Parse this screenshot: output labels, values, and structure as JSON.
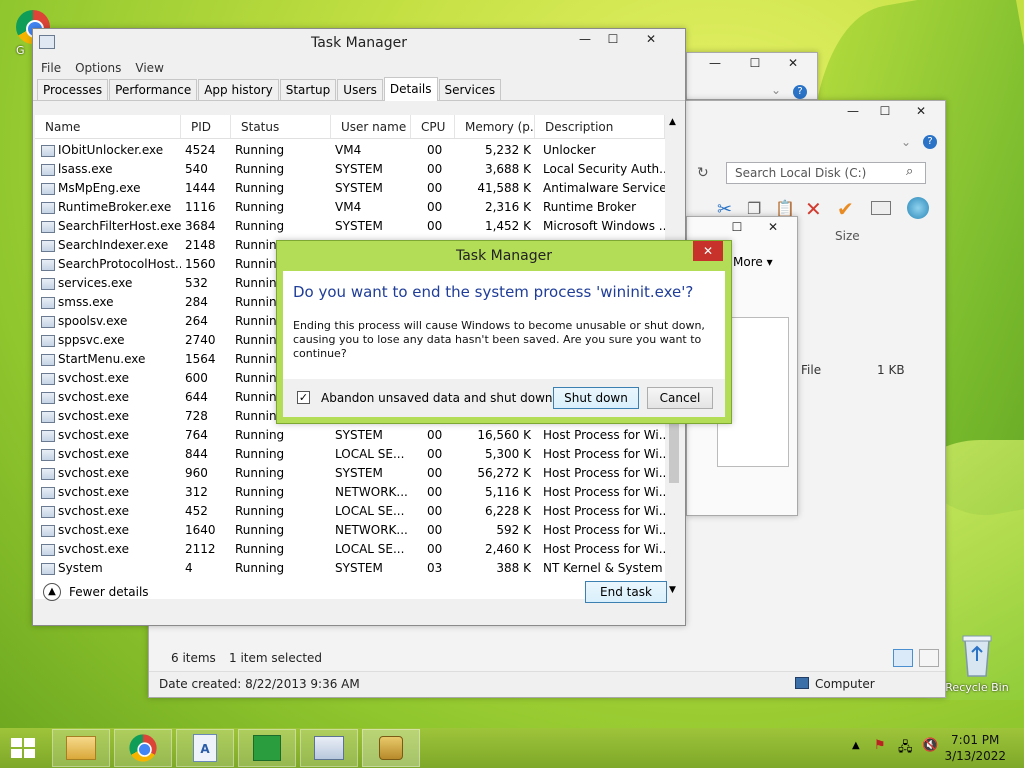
{
  "desktop": {
    "icons": [
      {
        "label": "G",
        "name": "chrome"
      },
      {
        "label": "Recycle Bin",
        "name": "recycle-bin"
      }
    ]
  },
  "task_manager": {
    "title": "Task Manager",
    "menu": [
      "File",
      "Options",
      "View"
    ],
    "tabs": [
      "Processes",
      "Performance",
      "App history",
      "Startup",
      "Users",
      "Details",
      "Services"
    ],
    "active_tab": "Details",
    "columns": [
      "Name",
      "PID",
      "Status",
      "User name",
      "CPU",
      "Memory (p...",
      "Description"
    ],
    "rows": [
      {
        "name": "IObitUnlocker.exe",
        "pid": "4524",
        "status": "Running",
        "user": "VM4",
        "cpu": "00",
        "mem": "5,232 K",
        "desc": "Unlocker"
      },
      {
        "name": "lsass.exe",
        "pid": "540",
        "status": "Running",
        "user": "SYSTEM",
        "cpu": "00",
        "mem": "3,688 K",
        "desc": "Local Security Auth..."
      },
      {
        "name": "MsMpEng.exe",
        "pid": "1444",
        "status": "Running",
        "user": "SYSTEM",
        "cpu": "00",
        "mem": "41,588 K",
        "desc": "Antimalware Service..."
      },
      {
        "name": "RuntimeBroker.exe",
        "pid": "1116",
        "status": "Running",
        "user": "VM4",
        "cpu": "00",
        "mem": "2,316 K",
        "desc": "Runtime Broker"
      },
      {
        "name": "SearchFilterHost.exe",
        "pid": "3684",
        "status": "Running",
        "user": "SYSTEM",
        "cpu": "00",
        "mem": "1,452 K",
        "desc": "Microsoft Windows ..."
      },
      {
        "name": "SearchIndexer.exe",
        "pid": "2148",
        "status": "Running",
        "user": "",
        "cpu": "",
        "mem": "",
        "desc": ""
      },
      {
        "name": "SearchProtocolHost...",
        "pid": "1560",
        "status": "Running",
        "user": "",
        "cpu": "",
        "mem": "",
        "desc": ""
      },
      {
        "name": "services.exe",
        "pid": "532",
        "status": "Running",
        "user": "",
        "cpu": "",
        "mem": "",
        "desc": ""
      },
      {
        "name": "smss.exe",
        "pid": "284",
        "status": "Running",
        "user": "",
        "cpu": "",
        "mem": "",
        "desc": ""
      },
      {
        "name": "spoolsv.exe",
        "pid": "264",
        "status": "Running",
        "user": "",
        "cpu": "",
        "mem": "",
        "desc": ""
      },
      {
        "name": "sppsvc.exe",
        "pid": "2740",
        "status": "Running",
        "user": "",
        "cpu": "",
        "mem": "",
        "desc": ""
      },
      {
        "name": "StartMenu.exe",
        "pid": "1564",
        "status": "Running",
        "user": "",
        "cpu": "",
        "mem": "",
        "desc": ""
      },
      {
        "name": "svchost.exe",
        "pid": "600",
        "status": "Running",
        "user": "",
        "cpu": "",
        "mem": "",
        "desc": ""
      },
      {
        "name": "svchost.exe",
        "pid": "644",
        "status": "Running",
        "user": "",
        "cpu": "",
        "mem": "",
        "desc": ""
      },
      {
        "name": "svchost.exe",
        "pid": "728",
        "status": "Running",
        "user": "",
        "cpu": "",
        "mem": "",
        "desc": ""
      },
      {
        "name": "svchost.exe",
        "pid": "764",
        "status": "Running",
        "user": "SYSTEM",
        "cpu": "00",
        "mem": "16,560 K",
        "desc": "Host Process for Wi..."
      },
      {
        "name": "svchost.exe",
        "pid": "844",
        "status": "Running",
        "user": "LOCAL SE...",
        "cpu": "00",
        "mem": "5,300 K",
        "desc": "Host Process for Wi..."
      },
      {
        "name": "svchost.exe",
        "pid": "960",
        "status": "Running",
        "user": "SYSTEM",
        "cpu": "00",
        "mem": "56,272 K",
        "desc": "Host Process for Wi..."
      },
      {
        "name": "svchost.exe",
        "pid": "312",
        "status": "Running",
        "user": "NETWORK...",
        "cpu": "00",
        "mem": "5,116 K",
        "desc": "Host Process for Wi..."
      },
      {
        "name": "svchost.exe",
        "pid": "452",
        "status": "Running",
        "user": "LOCAL SE...",
        "cpu": "00",
        "mem": "6,228 K",
        "desc": "Host Process for Wi..."
      },
      {
        "name": "svchost.exe",
        "pid": "1640",
        "status": "Running",
        "user": "NETWORK...",
        "cpu": "00",
        "mem": "592 K",
        "desc": "Host Process for Wi..."
      },
      {
        "name": "svchost.exe",
        "pid": "2112",
        "status": "Running",
        "user": "LOCAL SE...",
        "cpu": "00",
        "mem": "2,460 K",
        "desc": "Host Process for Wi..."
      },
      {
        "name": "System",
        "pid": "4",
        "status": "Running",
        "user": "SYSTEM",
        "cpu": "03",
        "mem": "388 K",
        "desc": "NT Kernel & System"
      }
    ],
    "fewer_details": "Fewer details",
    "end_task": "End task"
  },
  "dialog": {
    "title": "Task Manager",
    "heading": "Do you want to end the system process 'wininit.exe'?",
    "body": "Ending this process will cause Windows to become unusable or shut down, causing you to lose any data hasn't been saved. Are you sure you want to continue?",
    "checkbox_label": "Abandon unsaved data and shut down.",
    "checkbox_checked": true,
    "primary_button": "Shut down",
    "cancel_button": "Cancel",
    "close_glyph": "✕"
  },
  "explorer": {
    "search_placeholder": "Search Local Disk (C:)",
    "more_label": "More",
    "size_header": "Size",
    "file_type": "File",
    "file_size": "1 KB",
    "items_count": "6 items",
    "selected_count": "1 item selected",
    "date_created": "Date created: 8/22/2013 9:36 AM",
    "computer_label": "Computer"
  },
  "taskbar": {
    "time": "7:01 PM",
    "date": "3/13/2022"
  },
  "colors": {
    "dialog_accent": "#b3dc57",
    "close_red": "#c7332a",
    "heading_blue": "#1f3d99"
  }
}
